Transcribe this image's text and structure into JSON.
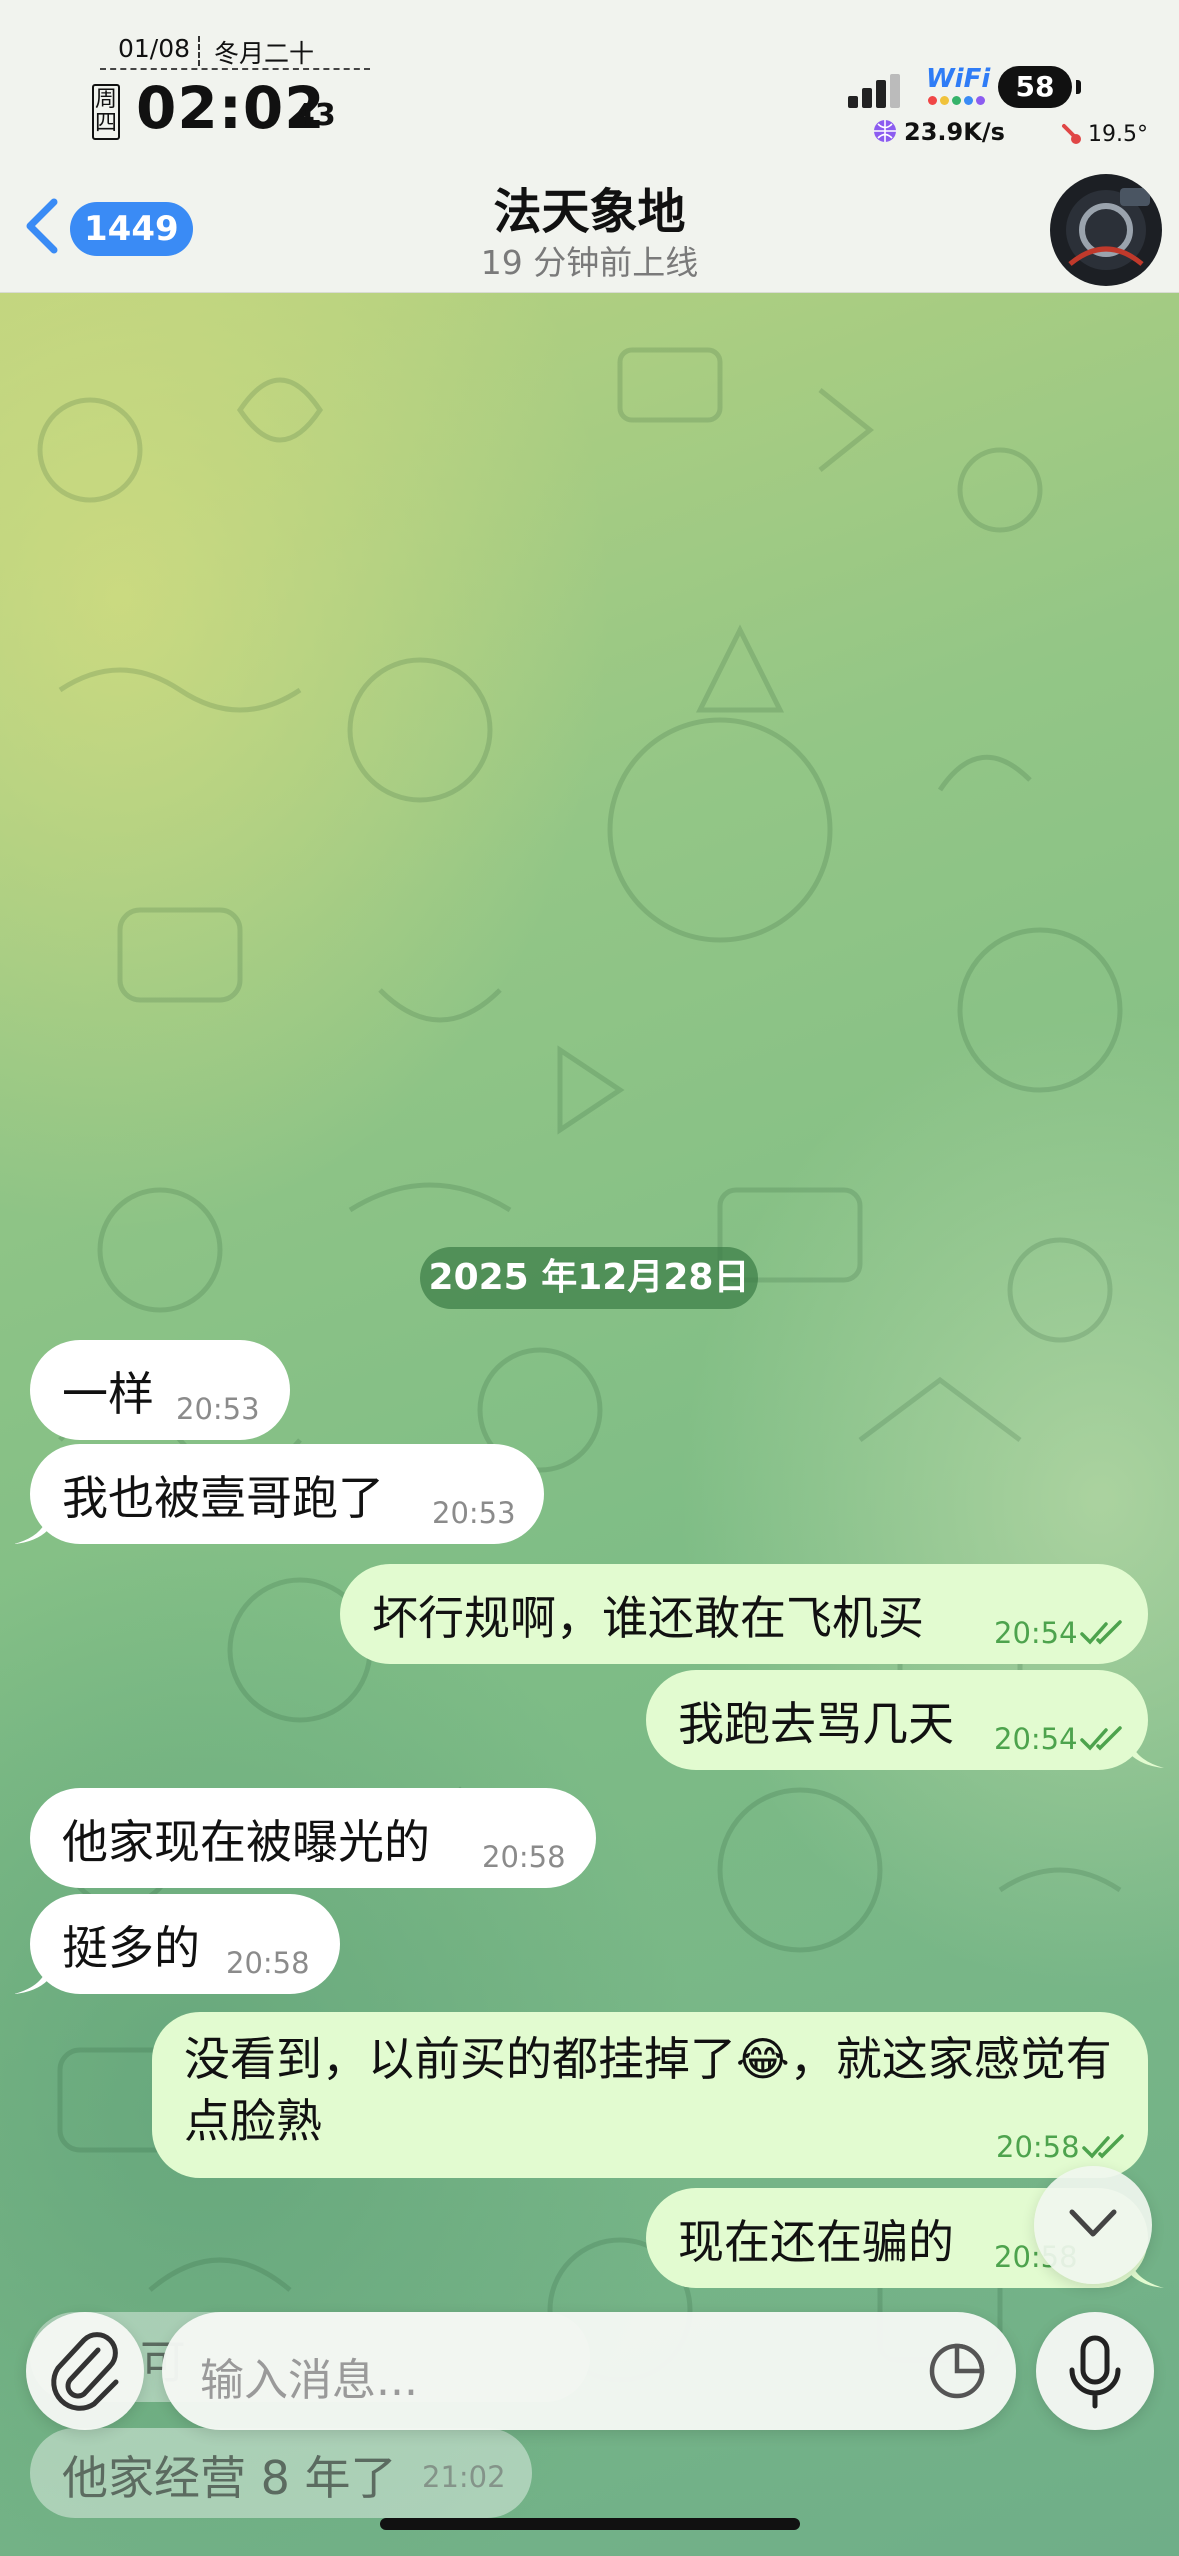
{
  "status_bar": {
    "date": "01/08",
    "lunar_date": "冬月二十",
    "weekday": "周四",
    "time": "02:02",
    "seconds": "43",
    "wifi_label": "WiFi",
    "battery": "58",
    "net_speed": "23.9K/s",
    "temperature": "19.5°"
  },
  "header": {
    "unread_count": "1449",
    "title": "法天象地",
    "subtitle": "19 分钟前上线"
  },
  "messages": [
    {
      "type": "date",
      "text": "2025 年12月28日"
    },
    {
      "dir": "in",
      "text": "一样",
      "time": "20:53"
    },
    {
      "dir": "in",
      "text": "我也被壹哥跑了",
      "time": "20:53"
    },
    {
      "dir": "out",
      "text": "坏行规啊，谁还敢在飞机买",
      "time": "20:54",
      "read": true
    },
    {
      "dir": "out",
      "text": "我跑去骂几天",
      "time": "20:54",
      "read": true
    },
    {
      "dir": "in",
      "text": "他家现在被曝光的",
      "time": "20:58"
    },
    {
      "dir": "in",
      "text": "挺多的",
      "time": "20:58"
    },
    {
      "dir": "out",
      "text": "没看到，以前买的都挂掉了😂，就这家感觉有点脸熟",
      "time": "20:58",
      "read": true
    },
    {
      "dir": "out",
      "text": "现在还在骗的",
      "time": "20:58",
      "read": true
    },
    {
      "dir": "in",
      "text": "可",
      "time": ""
    },
    {
      "dir": "in",
      "text": "他家经营 8 年了",
      "time": "21:02"
    }
  ],
  "input": {
    "placeholder": "输入消息..."
  },
  "colors": {
    "accent": "#3a8bf5",
    "outgoing_bubble": "#e2fbd0",
    "incoming_bubble": "#ffffff",
    "read_check": "#4da34d",
    "date_pill": "#3c7d46"
  },
  "icons": [
    "chevron-left-icon",
    "paperclip-icon",
    "sticker-icon",
    "microphone-icon",
    "chevron-down-icon",
    "double-check-icon",
    "globe-icon",
    "thermometer-icon",
    "signal-icon"
  ]
}
